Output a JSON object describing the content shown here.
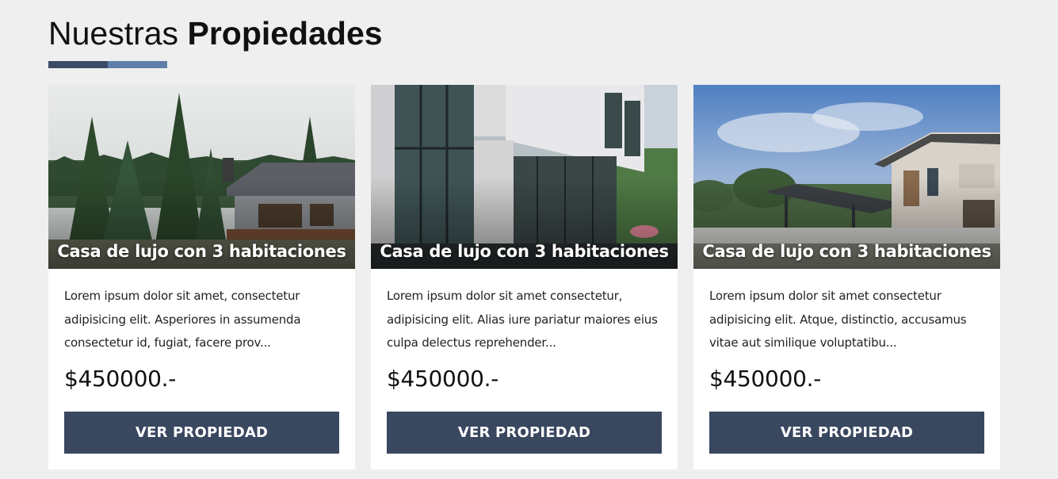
{
  "section": {
    "title_regular": "Nuestras",
    "title_bold": "Propiedades",
    "accent_dark": "#3b4a66",
    "accent_light": "#5f7fa8"
  },
  "properties": [
    {
      "title": "Casa de lujo con 3 habitaciones",
      "description": "Lorem ipsum dolor sit amet, consectetur adipisicing elit. Asperiores in assumenda consectetur id, fugiat, facere prov...",
      "price": "$450000.-",
      "button_label": "VER PROPIEDAD",
      "image": "wooden-house-in-pine-forest"
    },
    {
      "title": "Casa de lujo con 3 habitaciones",
      "description": "Lorem ipsum dolor sit amet consectetur, adipisicing elit. Alias iure pariatur maiores eius culpa delectus reprehender...",
      "price": "$450000.-",
      "button_label": "VER PROPIEDAD",
      "image": "modern-glass-house-with-pool"
    },
    {
      "title": "Casa de lujo con 3 habitaciones",
      "description": "Lorem ipsum dolor sit amet consectetur adipisicing elit. Atque, distinctio, accusamus vitae aut similique voluptatibu...",
      "price": "$450000.-",
      "button_label": "VER PROPIEDAD",
      "image": "modern-house-with-carport"
    }
  ],
  "button_color": "#39475f",
  "card_bg": "#ffffff",
  "page_bg": "#efefef"
}
